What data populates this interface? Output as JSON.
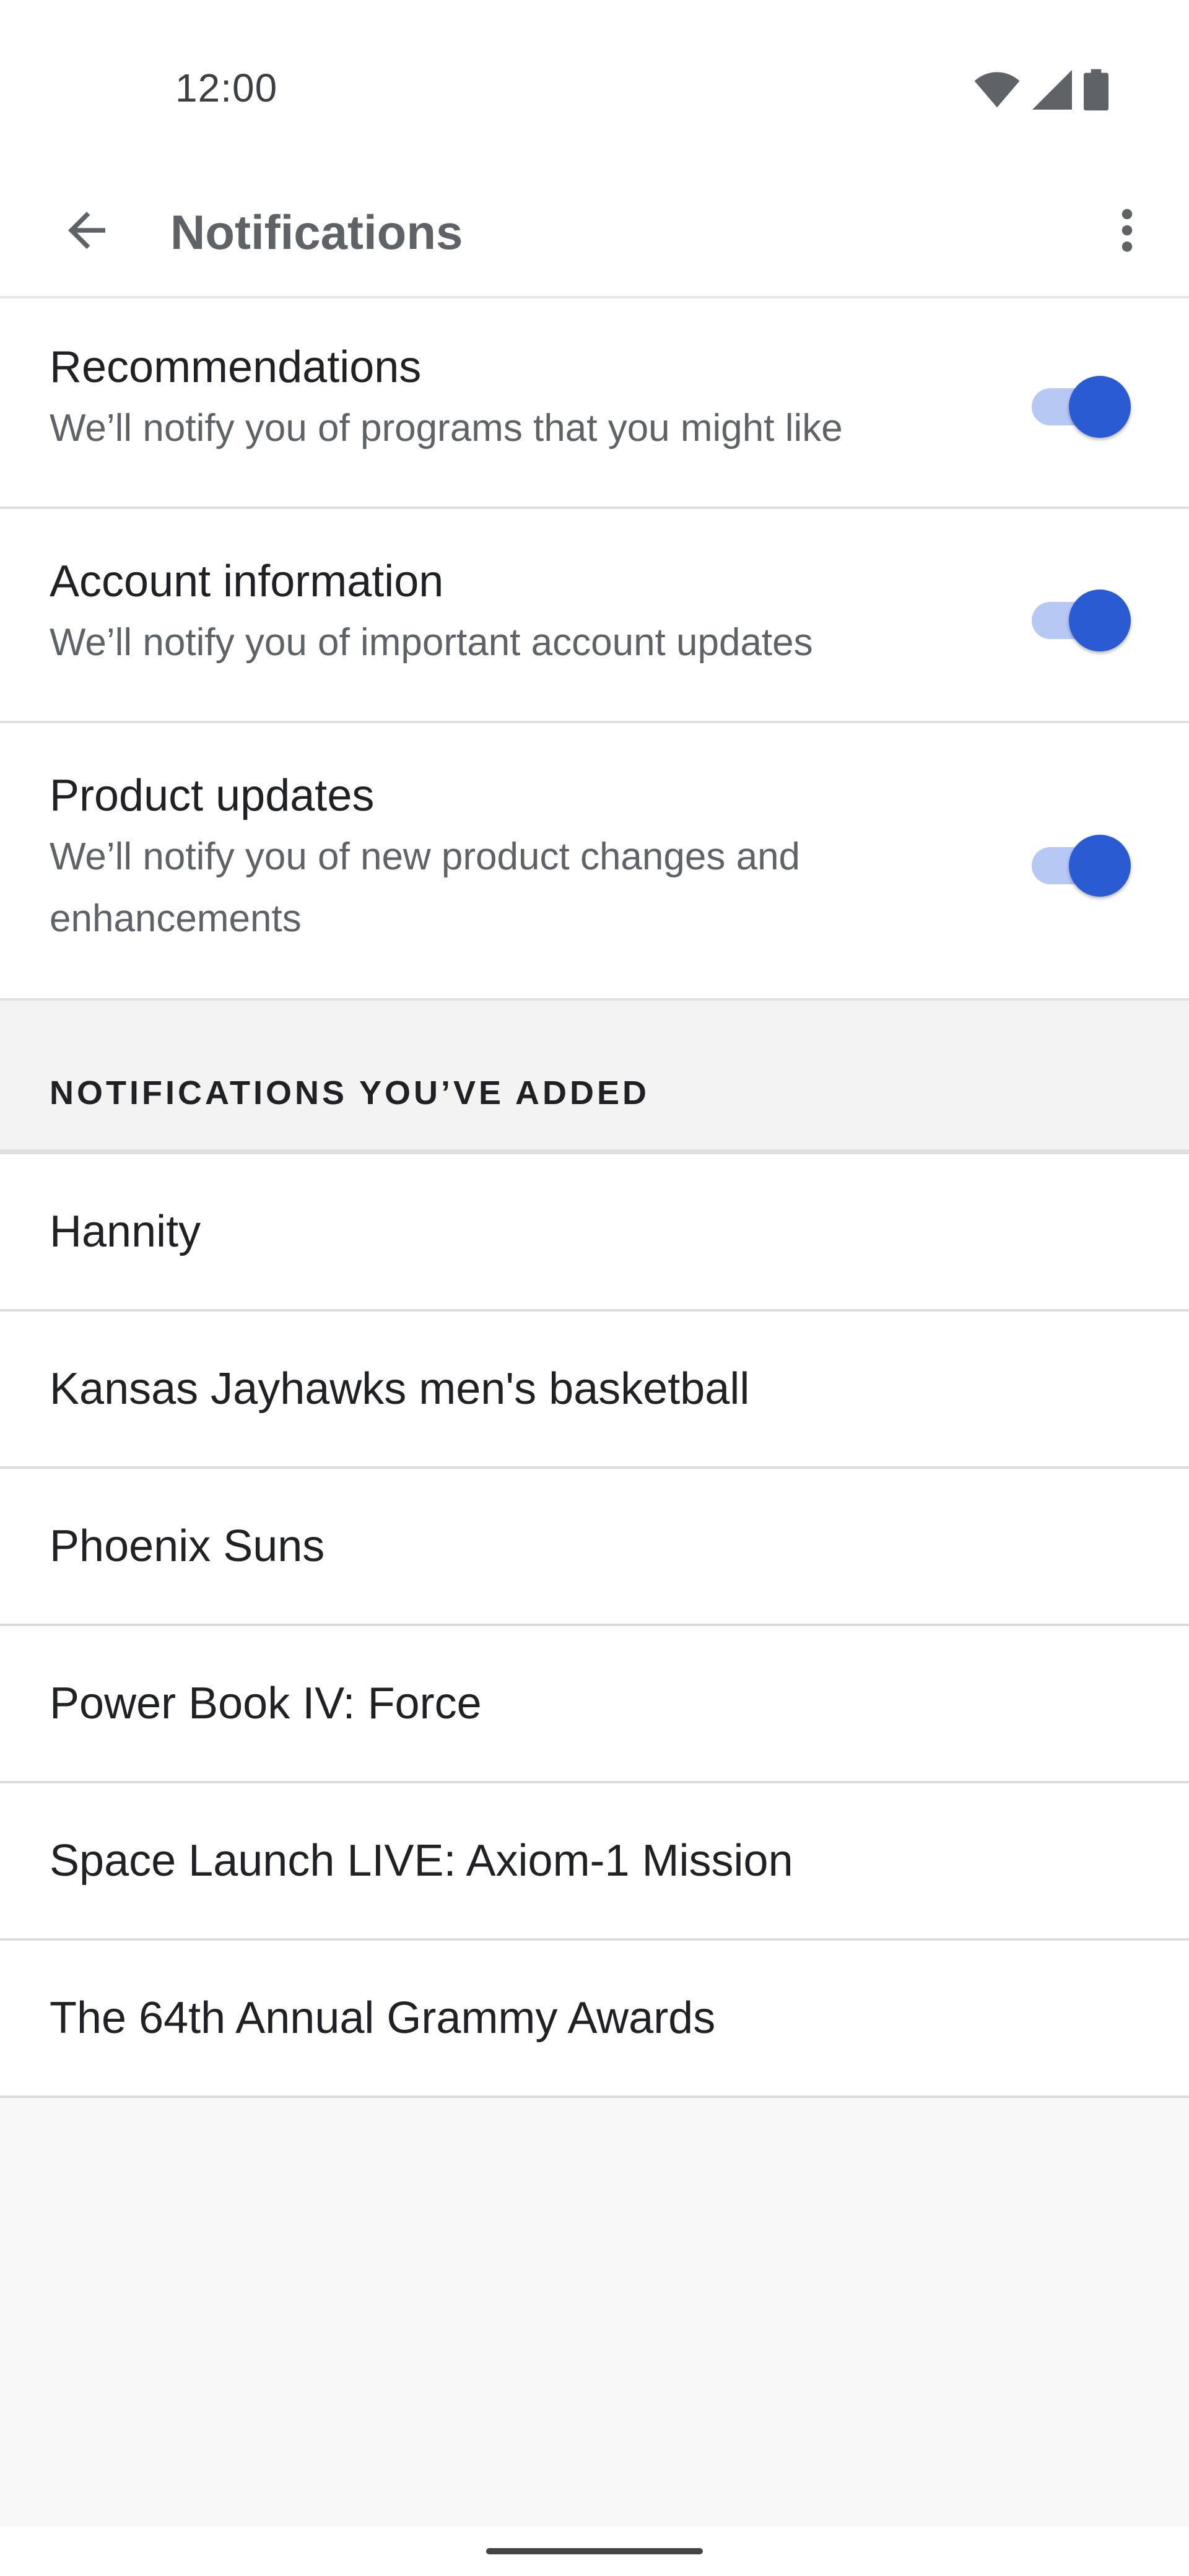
{
  "status_bar": {
    "time": "12:00",
    "icons": [
      "wifi-icon",
      "cell-signal-icon",
      "battery-icon"
    ]
  },
  "app_bar": {
    "title": "Notifications",
    "back_icon": "arrow-back-icon",
    "overflow_icon": "more-vert-icon"
  },
  "settings": [
    {
      "title": "Recommendations",
      "subtitle": "We’ll notify you of programs that you might like",
      "enabled": true
    },
    {
      "title": "Account information",
      "subtitle": "We’ll notify you of important account updates",
      "enabled": true
    },
    {
      "title": "Product updates",
      "subtitle": "We’ll notify you of new product changes and enhancements",
      "enabled": true
    }
  ],
  "added_section": {
    "header": "NOTIFICATIONS YOU’VE ADDED",
    "items": [
      "Hannity",
      "Kansas Jayhawks men's basketball",
      "Phoenix Suns",
      "Power Book IV: Force",
      "Space Launch LIVE: Axiom-1 Mission",
      "The 64th Annual Grammy Awards"
    ]
  },
  "colors": {
    "accent": "#2a5bd2",
    "accent_track": "#b7c8f5",
    "text_primary": "#202124",
    "text_secondary": "#5f6368"
  }
}
